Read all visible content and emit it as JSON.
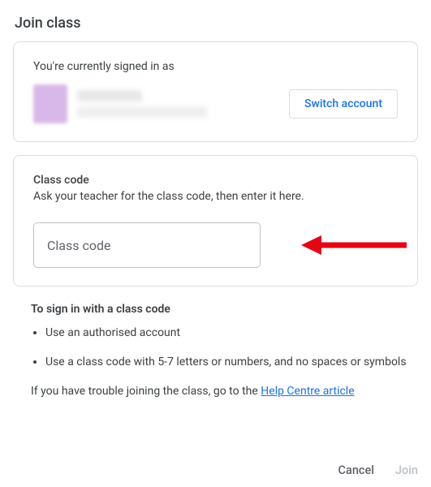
{
  "title": "Join class",
  "account_card": {
    "signed_in_text": "You're currently signed in as",
    "switch_label": "Switch account"
  },
  "class_code_card": {
    "label": "Class code",
    "desc": "Ask your teacher for the class code, then enter it here.",
    "placeholder": "Class code"
  },
  "info": {
    "title": "To sign in with a class code",
    "items": [
      "Use an authorised account",
      "Use a class code with 5-7 letters or numbers, and no spaces or symbols"
    ],
    "trouble_prefix": "If you have trouble joining the class, go to the ",
    "help_link": "Help Centre article"
  },
  "footer": {
    "cancel": "Cancel",
    "join": "Join"
  }
}
